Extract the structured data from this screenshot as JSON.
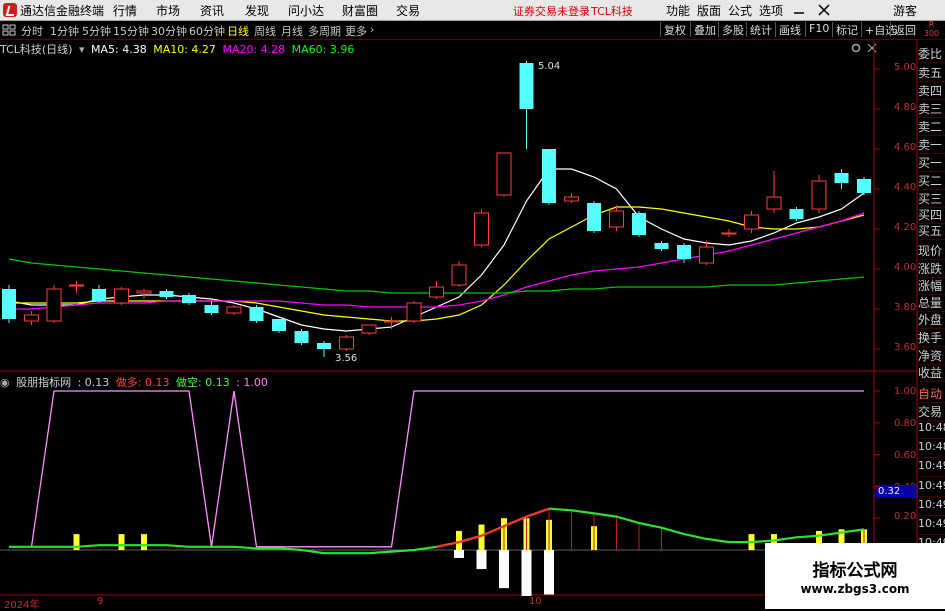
{
  "menu": {
    "app_name": "通达信金融终端",
    "items": [
      "行情",
      "市场",
      "资讯",
      "发现",
      "问小达",
      "财富圈",
      "交易"
    ],
    "broker_status": "证券交易未登录",
    "stock_name": "TCL科技",
    "right_items": [
      "功能",
      "版面",
      "公式",
      "选项"
    ],
    "guest": "游客"
  },
  "timeframes": [
    "分时",
    "1分钟",
    "5分钟",
    "15分钟",
    "30分钟",
    "60分钟",
    "日线",
    "周线",
    "月线",
    "多周期",
    "更多"
  ],
  "active_timeframe": "日线",
  "tools": [
    "复权",
    "叠加",
    "多股",
    "统计",
    "画线",
    "F10",
    "标记",
    "+自选",
    "返回"
  ],
  "legend": {
    "title": "TCL科技(日线)",
    "ma5": "MA5: 4.38",
    "ma10": "MA10: 4.27",
    "ma20": "MA20: 4.28",
    "ma60": "MA60: 3.96"
  },
  "indicator_legend": {
    "name": "股朋指标网",
    "value": ": 0.13",
    "long_label": "做多: 0.13",
    "short_label": "做空: 0.13",
    "max_label": ": 1.00"
  },
  "right_panel": {
    "corner": "R\n300",
    "items": [
      "委比",
      "卖五",
      "卖四",
      "卖三",
      "卖二",
      "卖一",
      "买一",
      "买二",
      "买三",
      "买四",
      "买五",
      "现价",
      "涨跌",
      "涨幅",
      "总量",
      "外盘",
      "换手",
      "净资",
      "收益"
    ],
    "auto_label": "自动",
    "trade_label": "交易",
    "times": [
      "10:48",
      "10:48",
      "10:49",
      "10:49",
      "10:49",
      "10:49",
      "10:49"
    ]
  },
  "price_axis": [
    "5.00",
    "4.80",
    "4.60",
    "4.40",
    "4.20",
    "4.00",
    "3.80",
    "3.60"
  ],
  "indicator_axis": [
    "1.00",
    "0.80",
    "0.60",
    "0.40",
    "0.20"
  ],
  "indicator_marker": "0.32",
  "x_axis": [
    "2024年",
    "9",
    "10"
  ],
  "high_label": "5.04",
  "low_label": "3.56",
  "watermark": {
    "title": "指标公式网",
    "url": "www.zbgs3.com"
  },
  "colors": {
    "up": "#ff3c3c",
    "down": "#54ffff",
    "ma5": "#ffffff",
    "ma10": "#ffff00",
    "ma20": "#ff00ff",
    "ma60": "#00c800",
    "axis": "#c03030"
  },
  "chart_data": {
    "type": "candlestick",
    "title": "TCL科技(日线)",
    "ylim": [
      3.5,
      5.1
    ],
    "candles": [
      {
        "o": 3.9,
        "c": 3.75,
        "h": 3.92,
        "l": 3.73
      },
      {
        "o": 3.74,
        "c": 3.77,
        "h": 3.79,
        "l": 3.72
      },
      {
        "o": 3.74,
        "c": 3.9,
        "h": 3.92,
        "l": 3.73
      },
      {
        "o": 3.92,
        "c": 3.92,
        "h": 3.94,
        "l": 3.88
      },
      {
        "o": 3.9,
        "c": 3.84,
        "h": 3.92,
        "l": 3.83
      },
      {
        "o": 3.83,
        "c": 3.9,
        "h": 3.91,
        "l": 3.82
      },
      {
        "o": 3.88,
        "c": 3.89,
        "h": 3.9,
        "l": 3.85
      },
      {
        "o": 3.89,
        "c": 3.86,
        "h": 3.9,
        "l": 3.85
      },
      {
        "o": 3.87,
        "c": 3.83,
        "h": 3.88,
        "l": 3.82
      },
      {
        "o": 3.82,
        "c": 3.78,
        "h": 3.84,
        "l": 3.77
      },
      {
        "o": 3.78,
        "c": 3.81,
        "h": 3.82,
        "l": 3.77
      },
      {
        "o": 3.81,
        "c": 3.74,
        "h": 3.82,
        "l": 3.73
      },
      {
        "o": 3.75,
        "c": 3.69,
        "h": 3.75,
        "l": 3.68
      },
      {
        "o": 3.69,
        "c": 3.63,
        "h": 3.7,
        "l": 3.62
      },
      {
        "o": 3.63,
        "c": 3.6,
        "h": 3.64,
        "l": 3.56
      },
      {
        "o": 3.6,
        "c": 3.66,
        "h": 3.67,
        "l": 3.59
      },
      {
        "o": 3.68,
        "c": 3.72,
        "h": 3.72,
        "l": 3.67
      },
      {
        "o": 3.74,
        "c": 3.74,
        "h": 3.76,
        "l": 3.7
      },
      {
        "o": 3.74,
        "c": 3.83,
        "h": 3.84,
        "l": 3.73
      },
      {
        "o": 3.86,
        "c": 3.91,
        "h": 3.94,
        "l": 3.85
      },
      {
        "o": 3.92,
        "c": 4.02,
        "h": 4.04,
        "l": 3.91
      },
      {
        "o": 4.12,
        "c": 4.28,
        "h": 4.3,
        "l": 4.11
      },
      {
        "o": 4.37,
        "c": 4.58,
        "h": 4.58,
        "l": 4.36
      },
      {
        "o": 5.03,
        "c": 4.8,
        "h": 5.04,
        "l": 4.6
      },
      {
        "o": 4.6,
        "c": 4.33,
        "h": 4.6,
        "l": 4.32
      },
      {
        "o": 4.34,
        "c": 4.36,
        "h": 4.38,
        "l": 4.33
      },
      {
        "o": 4.33,
        "c": 4.19,
        "h": 4.34,
        "l": 4.18
      },
      {
        "o": 4.21,
        "c": 4.29,
        "h": 4.32,
        "l": 4.19
      },
      {
        "o": 4.28,
        "c": 4.17,
        "h": 4.29,
        "l": 4.16
      },
      {
        "o": 4.13,
        "c": 4.1,
        "h": 4.14,
        "l": 4.09
      },
      {
        "o": 4.12,
        "c": 4.05,
        "h": 4.13,
        "l": 4.03
      },
      {
        "o": 4.03,
        "c": 4.11,
        "h": 4.14,
        "l": 4.02
      },
      {
        "o": 4.18,
        "c": 4.18,
        "h": 4.2,
        "l": 4.16
      },
      {
        "o": 4.2,
        "c": 4.27,
        "h": 4.29,
        "l": 4.18
      },
      {
        "o": 4.3,
        "c": 4.36,
        "h": 4.49,
        "l": 4.28
      },
      {
        "o": 4.3,
        "c": 4.25,
        "h": 4.31,
        "l": 4.24
      },
      {
        "o": 4.3,
        "c": 4.44,
        "h": 4.47,
        "l": 4.28
      },
      {
        "o": 4.48,
        "c": 4.43,
        "h": 4.5,
        "l": 4.4
      },
      {
        "o": 4.45,
        "c": 4.38,
        "h": 4.46,
        "l": 4.37
      }
    ],
    "series": [
      {
        "name": "MA5",
        "values": [
          3.84,
          3.82,
          3.82,
          3.82,
          3.85,
          3.86,
          3.87,
          3.87,
          3.86,
          3.85,
          3.83,
          3.8,
          3.76,
          3.72,
          3.7,
          3.69,
          3.7,
          3.71,
          3.76,
          3.81,
          3.86,
          3.97,
          4.12,
          4.34,
          4.5,
          4.5,
          4.46,
          4.4,
          4.26,
          4.2,
          4.15,
          4.13,
          4.12,
          4.14,
          4.18,
          4.23,
          4.26,
          4.3,
          4.38
        ]
      },
      {
        "name": "MA10",
        "values": [
          3.83,
          3.83,
          3.83,
          3.83,
          3.84,
          3.84,
          3.84,
          3.84,
          3.84,
          3.84,
          3.84,
          3.83,
          3.81,
          3.79,
          3.77,
          3.76,
          3.75,
          3.74,
          3.74,
          3.75,
          3.77,
          3.82,
          3.92,
          4.04,
          4.15,
          4.21,
          4.27,
          4.31,
          4.31,
          4.3,
          4.28,
          4.26,
          4.24,
          4.21,
          4.2,
          4.2,
          4.21,
          4.24,
          4.27
        ]
      },
      {
        "name": "MA20",
        "values": [
          3.8,
          3.8,
          3.81,
          3.82,
          3.83,
          3.83,
          3.83,
          3.84,
          3.84,
          3.84,
          3.84,
          3.84,
          3.84,
          3.83,
          3.82,
          3.82,
          3.81,
          3.81,
          3.81,
          3.81,
          3.82,
          3.84,
          3.87,
          3.91,
          3.94,
          3.97,
          3.99,
          4.0,
          4.01,
          4.03,
          4.05,
          4.07,
          4.09,
          4.12,
          4.15,
          4.18,
          4.21,
          4.24,
          4.28
        ]
      },
      {
        "name": "MA60",
        "values": [
          4.05,
          4.03,
          4.02,
          4.01,
          4.0,
          3.99,
          3.98,
          3.97,
          3.96,
          3.95,
          3.94,
          3.93,
          3.92,
          3.91,
          3.9,
          3.89,
          3.89,
          3.88,
          3.88,
          3.88,
          3.88,
          3.88,
          3.88,
          3.89,
          3.89,
          3.9,
          3.9,
          3.91,
          3.91,
          3.91,
          3.91,
          3.91,
          3.92,
          3.92,
          3.92,
          3.93,
          3.94,
          3.95,
          3.96
        ]
      }
    ],
    "indicator": {
      "ylim": [
        0,
        1.05
      ],
      "signal": [
        0.02,
        0.02,
        1.0,
        1.0,
        1.0,
        1.0,
        1.0,
        1.0,
        1.0,
        0.02,
        1.0,
        0.02,
        0.02,
        0.02,
        0.02,
        0.02,
        0.02,
        0.02,
        1.0,
        1.0,
        1.0,
        1.0,
        1.0,
        1.0,
        1.0,
        1.0,
        1.0,
        1.0,
        1.0,
        1.0,
        1.0,
        1.0,
        1.0,
        1.0,
        1.0,
        1.0,
        1.0,
        1.0,
        1.0
      ],
      "long_line": [
        0.02,
        0.02,
        0.02,
        0.02,
        0.03,
        0.03,
        0.03,
        0.03,
        0.02,
        0.02,
        0.02,
        0.01,
        0.01,
        0.0,
        -0.02,
        -0.02,
        -0.02,
        -0.01,
        0.0,
        0.02,
        0.05,
        0.09,
        0.15,
        0.21,
        0.26,
        0.25,
        0.23,
        0.21,
        0.17,
        0.14,
        0.1,
        0.07,
        0.05,
        0.05,
        0.06,
        0.08,
        0.09,
        0.11,
        0.13
      ],
      "long_bars": [
        0,
        0,
        0,
        0.1,
        0,
        0.1,
        0.1,
        0,
        0,
        0,
        0,
        0,
        0,
        0,
        0,
        0,
        0,
        0,
        0,
        0,
        0.12,
        0.16,
        0.2,
        0.2,
        0.19,
        0,
        0.15,
        0,
        0,
        0,
        0,
        0,
        0,
        0.1,
        0.1,
        0,
        0.12,
        0.13,
        0.13
      ],
      "short_bars": [
        0,
        0,
        0,
        0,
        0,
        0,
        0,
        0,
        0,
        0,
        0,
        0,
        0,
        0,
        0,
        0,
        0,
        0,
        0,
        0,
        -0.05,
        -0.12,
        -0.24,
        -0.3,
        -0.28,
        0,
        0,
        0,
        0,
        0,
        0,
        0,
        0,
        0,
        0,
        0,
        0,
        0,
        0
      ]
    }
  }
}
